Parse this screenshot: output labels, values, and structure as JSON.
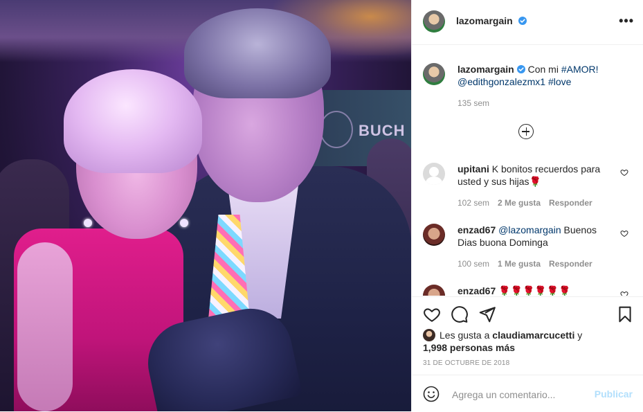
{
  "post": {
    "username": "lazomargain",
    "more_label": "•••",
    "caption": {
      "text": "Con mi",
      "hashtag_amor": "#AMOR!",
      "mention": "@edithgonzalezmx1",
      "hashtag_love": "#love"
    },
    "caption_time": "135 sem",
    "photo": {
      "banner_text": "BUCH"
    }
  },
  "comments": [
    {
      "username": "upitani",
      "text": "K bonitos recuerdos para usted y sus hijas🌹",
      "time": "102 sem",
      "likes": "2 Me gusta",
      "reply": "Responder"
    },
    {
      "username": "enzad67",
      "mention": "@lazomargain",
      "text": "Buenos Dias buona Dominga",
      "time": "100 sem",
      "likes": "1 Me gusta",
      "reply": "Responder"
    },
    {
      "username": "enzad67",
      "text": "🌹🌹🌹🌹🌹🌹"
    }
  ],
  "likes": {
    "prefix": "Les gusta a",
    "liker": "claudiamarcucetti",
    "conj": "y",
    "others": "1,998 personas más"
  },
  "date": "31 DE OCTUBRE DE 2018",
  "add_comment": {
    "placeholder": "Agrega un comentario...",
    "publish_label": "Publicar"
  },
  "colors": {
    "verified": "#3897f0",
    "link": "#00376b",
    "publish_disabled": "#b2dffc",
    "muted": "#8e8e8e"
  }
}
